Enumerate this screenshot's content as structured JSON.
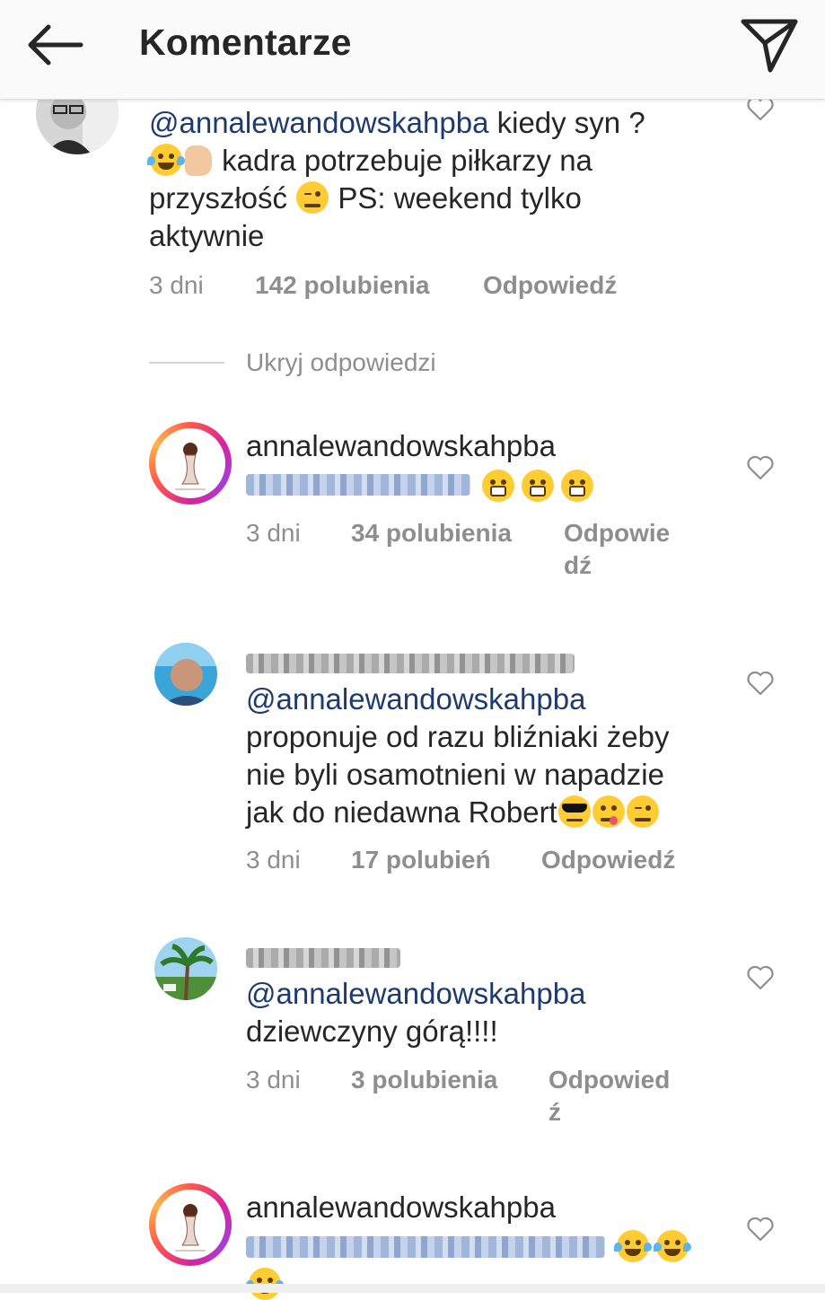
{
  "header": {
    "title": "Komentarze",
    "back_icon": "arrow-left-icon",
    "share_icon": "paper-plane-icon"
  },
  "comments": [
    {
      "avatar": "man-glasses-avatar",
      "mention": "@annalewandowskahpba",
      "text_line1_rest": " kiedy syn ?",
      "text_line2": " kadra potrzebuje piłkarzy na",
      "text_line3": "przyszłość ",
      "text_line3_rest": " PS: weekend tylko",
      "text_line4": "aktywnie",
      "time": "3 dni",
      "likes": "142 polubienia",
      "reply": "Odpowiedź"
    },
    {
      "username": "annalewandowskahpba",
      "time": "3 dni",
      "likes": "34 polubienia",
      "reply_line1": "Odpowie",
      "reply_line2": "dź"
    },
    {
      "mention": "@annalewandowskahpba",
      "text_line1": "proponuje od razu bliźniaki żeby",
      "text_line2": "nie byli osamotnieni w napadzie",
      "text_line3": "jak do niedawna Robert",
      "time": "3 dni",
      "likes": "17 polubień",
      "reply": "Odpowiedź"
    },
    {
      "mention": "@annalewandowskahpba",
      "text_line1": "dziewczyny górą!!!!",
      "time": "3 dni",
      "likes": "3 polubienia",
      "reply_line1": "Odpowied",
      "reply_line2": "ź"
    },
    {
      "username": "annalewandowskahpba"
    }
  ],
  "hide_replies": "Ukryj odpowiedzi",
  "colors": {
    "mention": "#1e3a6e",
    "meta": "#8e8e8e",
    "text": "#262626"
  }
}
